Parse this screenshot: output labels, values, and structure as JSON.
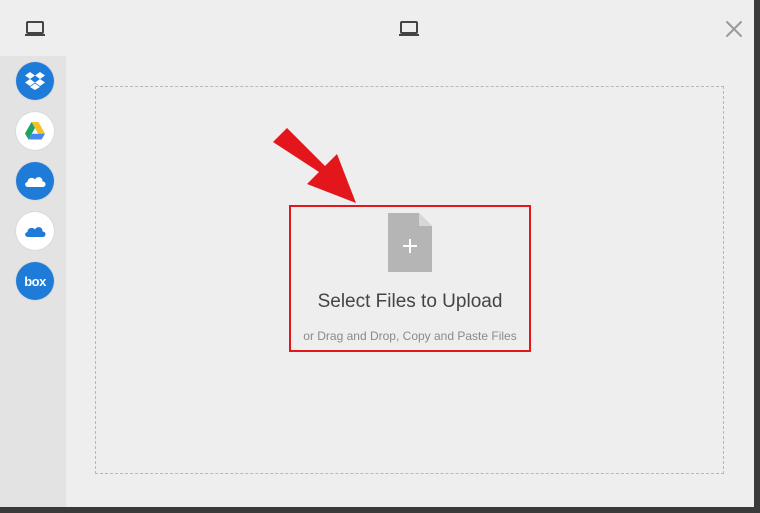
{
  "header": {
    "left_icon": "laptop-icon",
    "center_icon": "laptop-icon",
    "close_icon": "close-icon"
  },
  "sidebar": {
    "sources": [
      {
        "name": "dropbox",
        "icon": "dropbox-icon",
        "bg": "#1e7bd8"
      },
      {
        "name": "google-drive",
        "icon": "google-drive-icon",
        "bg": "#ffffff"
      },
      {
        "name": "onedrive",
        "icon": "onedrive-cloud-icon",
        "bg": "#1e7bd8"
      },
      {
        "name": "onedrive-business",
        "icon": "onedrive-cloud-icon",
        "bg": "#ffffff"
      },
      {
        "name": "box",
        "icon": "box-icon",
        "bg": "#1e7bd8",
        "label": "box"
      }
    ]
  },
  "upload": {
    "title": "Select Files to Upload",
    "hint": "or Drag and Drop, Copy and Paste Files",
    "file_icon": "file-plus-icon"
  },
  "annotation": {
    "arrow_color": "#e3161c",
    "box_color": "#e3161c"
  }
}
